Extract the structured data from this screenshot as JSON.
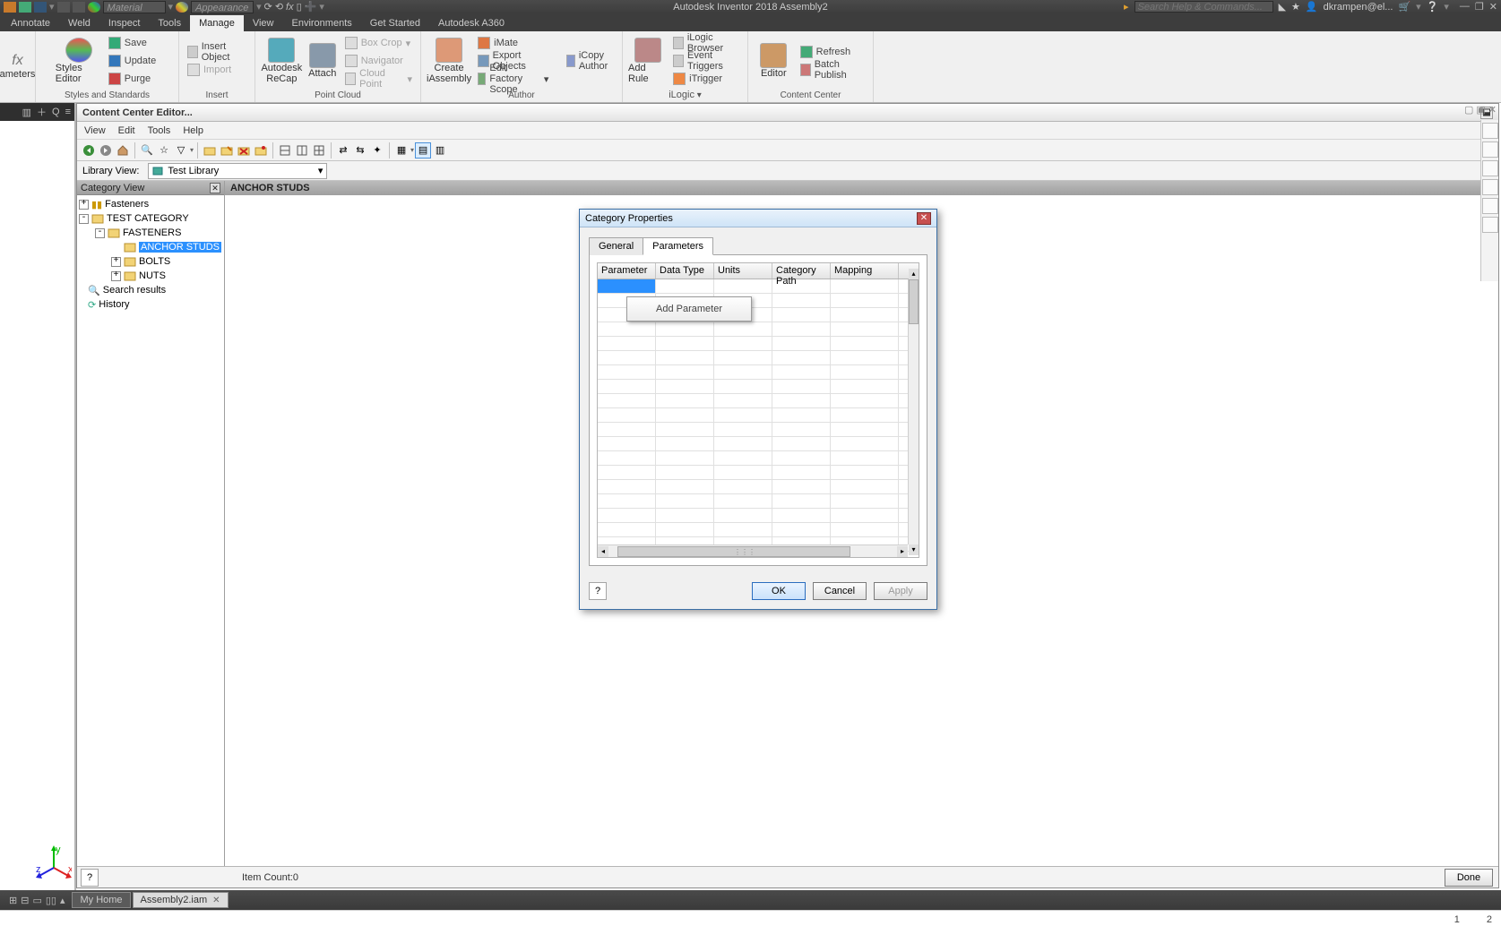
{
  "app": {
    "title": "Autodesk Inventor 2018   Assembly2",
    "material": "Material",
    "appearance": "Appearance",
    "searchPlaceholder": "Search Help & Commands...",
    "user": "dkrampen@el..."
  },
  "ribbonTabs": [
    "Annotate",
    "Weld",
    "Inspect",
    "Tools",
    "Manage",
    "View",
    "Environments",
    "Get Started",
    "Autodesk A360"
  ],
  "activeTab": "Manage",
  "panels": {
    "parameters": {
      "label": "ameters",
      "big": "f"
    },
    "styles": {
      "label": "Styles and Standards",
      "big": "Styles Editor",
      "items": [
        "Save",
        "Update",
        "Purge"
      ]
    },
    "insert": {
      "label": "Insert",
      "items": [
        "Insert Object",
        "Import"
      ]
    },
    "pointcloud": {
      "label": "Point Cloud",
      "recap": "Autodesk\nReCap",
      "attach": "Attach",
      "items": [
        "Box Crop",
        "Navigator",
        "Cloud Point"
      ]
    },
    "author": {
      "label": "Author",
      "big": "Create\niAssembly",
      "items": [
        "iMate",
        "Export Objects",
        "Edit Factory Scope"
      ]
    },
    "icopy": {
      "items": [
        "iCopy Author"
      ]
    },
    "ilogic": {
      "label": "iLogic",
      "big": "Add Rule",
      "items": [
        "iLogic Browser",
        "Event Triggers",
        "iTrigger"
      ]
    },
    "cc": {
      "label": "Content Center",
      "big": "Editor",
      "items": [
        "Refresh",
        "Batch Publish"
      ]
    }
  },
  "cce": {
    "title": "Content Center Editor...",
    "menus": [
      "View",
      "Edit",
      "Tools",
      "Help"
    ],
    "libLabel": "Library View:",
    "lib": "Test Library",
    "catViewTitle": "Category View",
    "tree": {
      "fasteners": "Fasteners",
      "testcat": "TEST CATEGORY",
      "fastenersSub": "FASTENERS",
      "anchor": "ANCHOR STUDS",
      "bolts": "BOLTS",
      "nuts": "NUTS",
      "search": "Search results",
      "history": "History"
    },
    "contentTitle": "ANCHOR STUDS",
    "itemCount": "Item Count:0",
    "done": "Done"
  },
  "dlg": {
    "title": "Category Properties",
    "tabs": [
      "General",
      "Parameters"
    ],
    "cols": [
      "Parameter ...",
      "Data Type",
      "Units",
      "Category Path",
      "Mapping"
    ],
    "ctx": "Add Parameter",
    "ok": "OK",
    "cancel": "Cancel",
    "apply": "Apply"
  },
  "bottomTabs": {
    "home": "My Home",
    "doc": "Assembly2.iam"
  },
  "status": {
    "a": "1",
    "b": "2"
  }
}
